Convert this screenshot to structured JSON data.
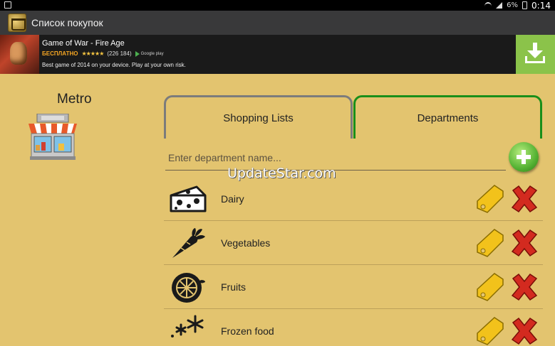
{
  "status_bar": {
    "battery": "6%",
    "time": "0:14"
  },
  "action_bar": {
    "title": "Список покупок"
  },
  "ad": {
    "title": "Game of War - Fire Age",
    "price_label": "БЕСПЛАТНО",
    "stars": "★★★★★",
    "rating_count": "(226 184)",
    "store_label": "Google play",
    "description": "Best game of 2014 on your device. Play at your own risk."
  },
  "store": {
    "name": "Metro"
  },
  "tabs": [
    {
      "label": "Shopping Lists",
      "active": false
    },
    {
      "label": "Departments",
      "active": true
    }
  ],
  "department_input": {
    "placeholder": "Enter department name...",
    "value": ""
  },
  "watermark": "UpdateStar.com",
  "departments": [
    {
      "label": "Dairy",
      "icon": "cheese-icon"
    },
    {
      "label": "Vegetables",
      "icon": "carrot-icon"
    },
    {
      "label": "Fruits",
      "icon": "citrus-icon"
    },
    {
      "label": "Frozen food",
      "icon": "snowflake-icon"
    }
  ],
  "colors": {
    "background": "#e3c46f",
    "action_bar": "#39393a",
    "active_tab_border": "#1a8f1a",
    "inactive_tab_border": "#7c7c7c",
    "add_button": "#55b233",
    "edit_icon": "#f2c21b",
    "delete_icon": "#d32a1f"
  }
}
